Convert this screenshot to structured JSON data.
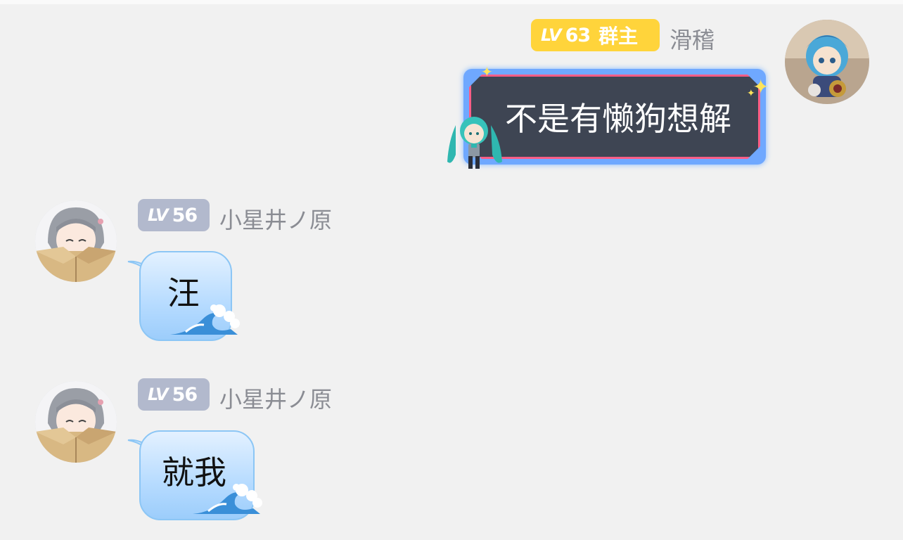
{
  "messages": [
    {
      "sender": "滑稽",
      "level_prefix": "LV",
      "level": "63",
      "role": "群主",
      "text": "不是有懒狗想解",
      "side": "right",
      "badge_color": "#ffd43b"
    },
    {
      "sender": "小星井ノ原",
      "level_prefix": "LV",
      "level": "56",
      "text": "汪",
      "side": "left",
      "badge_color": "#b2b9cd"
    },
    {
      "sender": "小星井ノ原",
      "level_prefix": "LV",
      "level": "56",
      "text": "就我",
      "side": "left",
      "badge_color": "#b2b9cd"
    }
  ],
  "colors": {
    "background": "#f1f1f1",
    "self_bubble_bg": "#3e4553",
    "neon_blue": "#6fa8ff",
    "neon_pink": "#ff5d86",
    "other_bubble": "#b6dbff",
    "name_text": "#8a8c93"
  },
  "icons": {
    "self_avatar": "avatar-plush-doll",
    "other_avatar": "avatar-anime-girl-box",
    "mascot": "miku-chibi-sticker",
    "wave": "wave-decoration",
    "sparkle": "sparkle-icon"
  }
}
